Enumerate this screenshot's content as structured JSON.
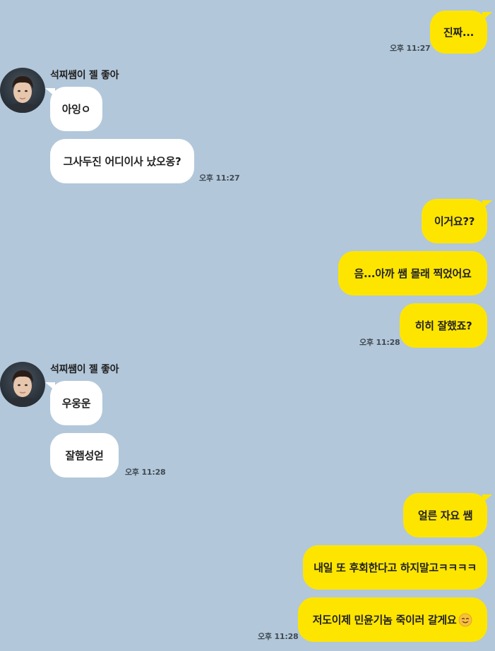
{
  "contact": {
    "name": "석찌쌤이 젤 좋아"
  },
  "messages": [
    {
      "text": "진짜..."
    },
    {
      "text": "아잉ㅇ"
    },
    {
      "text": "그사두진 어디이사 났오옹?"
    },
    {
      "text": "이거요??"
    },
    {
      "text": "음...아까 쌤 몰래 찍었어요"
    },
    {
      "text": "히히 잘했죠?"
    },
    {
      "text": "우웅운"
    },
    {
      "text": "잘햄성얻"
    },
    {
      "text": "얼른 자요 쌤"
    },
    {
      "text": "내일 또 후회한다고 하지말고ㅋㅋㅋㅋ"
    },
    {
      "text": "저도이제 민윤기놈 죽이러 갈게요"
    }
  ],
  "times": [
    "오후 11:27",
    "오후 11:27",
    "오후 11:28",
    "오후 11:28",
    "오후 11:28"
  ],
  "colors": {
    "background": "#b2c7da",
    "outgoing_bubble": "#fee500",
    "incoming_bubble": "#ffffff"
  },
  "icons": {
    "emoji": "smiling-face-icon"
  }
}
